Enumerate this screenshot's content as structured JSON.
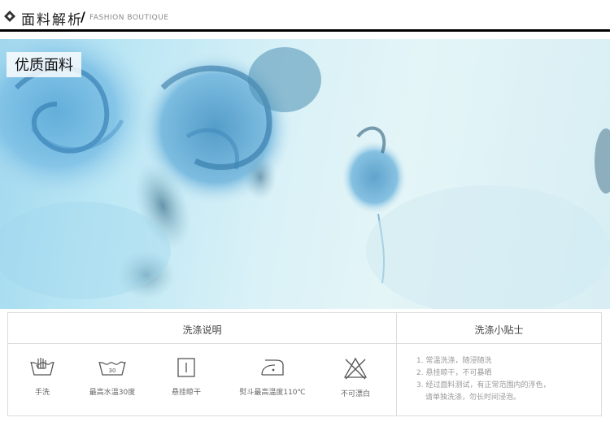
{
  "header": {
    "title": "面料解析",
    "separator": "/",
    "subtitle": "FASHION BOUTIQUE",
    "icon": "diamond-icon"
  },
  "fabric": {
    "label": "优质面料",
    "colors": {
      "light": "#e4f5f7",
      "mid": "#9fd7ee",
      "flower": "#3f8fc2",
      "dark": "#2f5f7a"
    }
  },
  "care": {
    "instructions_title": "洗涤说明",
    "tips_title": "洗涤小贴士",
    "items": [
      {
        "icon": "hand-wash-icon",
        "label": "手洗"
      },
      {
        "icon": "wash-30-icon",
        "label": "最高水温30度",
        "temp": "30"
      },
      {
        "icon": "hang-dry-icon",
        "label": "悬挂晾干"
      },
      {
        "icon": "iron-icon",
        "label": "熨斗最高温度110℃"
      },
      {
        "icon": "no-bleach-icon",
        "label": "不可漂白"
      }
    ],
    "tips": [
      "1. 常温洗涤，随浸随洗",
      "2. 悬挂晾干，不可暴晒",
      "3. 经过面料测试，有正常范围内的浮色，",
      "请单独洗涤，勿长时间浸泡。"
    ]
  }
}
